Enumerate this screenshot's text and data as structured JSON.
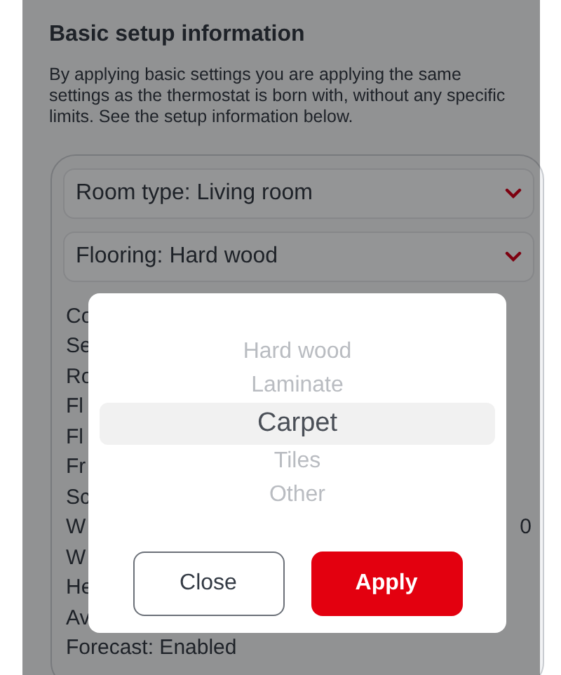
{
  "heading": "Basic setup information",
  "description": "By applying basic settings you are applying the same settings as the thermostat is born with, without any specific limits. See the setup information below.",
  "dropdowns": [
    {
      "label": "Room type: Living room"
    },
    {
      "label": "Flooring: Hard wood"
    }
  ],
  "info_lines": [
    {
      "text": "Co"
    },
    {
      "text": "Se"
    },
    {
      "text": "Ro"
    },
    {
      "text": "Fl"
    },
    {
      "text": "Fl"
    },
    {
      "text": "Fr"
    },
    {
      "text": "Sc"
    },
    {
      "text": "W",
      "trailing": "0"
    },
    {
      "text": "W"
    },
    {
      "text": "He"
    },
    {
      "text": "Av"
    },
    {
      "text": "Forecast: Enabled"
    }
  ],
  "picker": {
    "options": [
      {
        "label": "Hard wood",
        "selected": false
      },
      {
        "label": "Laminate",
        "selected": false
      },
      {
        "label": "Carpet",
        "selected": true
      },
      {
        "label": "Tiles",
        "selected": false
      },
      {
        "label": "Other",
        "selected": false
      }
    ],
    "buttons": [
      {
        "label": "Close",
        "kind": "secondary"
      },
      {
        "label": "Apply",
        "kind": "primary"
      }
    ]
  }
}
